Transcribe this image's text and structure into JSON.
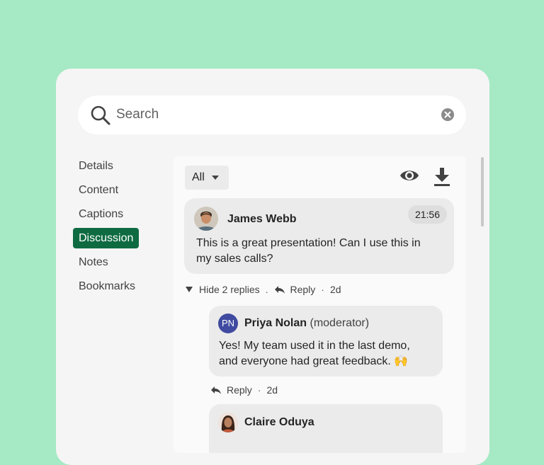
{
  "search": {
    "placeholder": "Search"
  },
  "sidebar": {
    "items": [
      {
        "label": "Details",
        "active": false
      },
      {
        "label": "Content",
        "active": false
      },
      {
        "label": "Captions",
        "active": false
      },
      {
        "label": "Discussion",
        "active": true
      },
      {
        "label": "Notes",
        "active": false
      },
      {
        "label": "Bookmarks",
        "active": false
      }
    ]
  },
  "toolbar": {
    "filter_value": "All",
    "icons": [
      "eye-icon",
      "download-icon"
    ]
  },
  "discussion": {
    "comment": {
      "author": "James Webb",
      "time": "21:56",
      "text": "This is a great presentation! Can I use this in my sales calls?",
      "thread_meta": {
        "hide_label": "Hide 2 replies",
        "dot": ".",
        "reply_label": "Reply",
        "middot": "·",
        "age": "2d"
      }
    },
    "replies": [
      {
        "initials": "PN",
        "author": "Priya Nolan",
        "role": "(moderator)",
        "text": "Yes! My team used it in the last demo, and everyone had great feedback. 🙌",
        "reply_label": "Reply",
        "middot": "·",
        "age": "2d"
      },
      {
        "author": "Claire Oduya"
      }
    ]
  },
  "colors": {
    "background": "#a6e9c5",
    "accent": "#0e6b41",
    "moderator_avatar": "#3f4aa0"
  }
}
